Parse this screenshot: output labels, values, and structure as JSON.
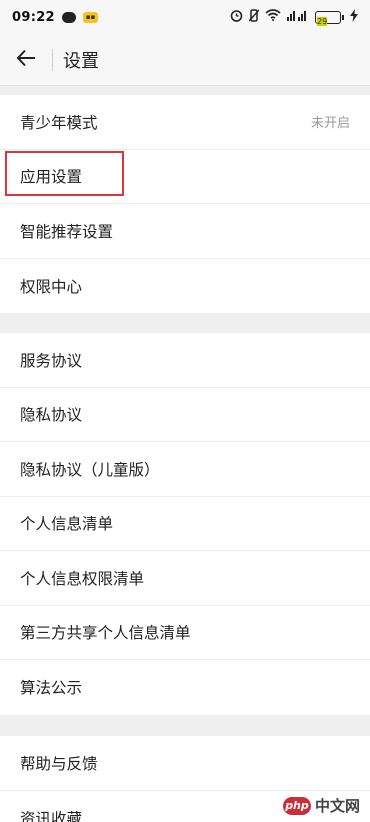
{
  "status_bar": {
    "time": "09:22",
    "battery_level": "29",
    "icons": [
      "wechat-icon",
      "app-badge-icon",
      "alarm-icon",
      "mute-icon",
      "wifi-icon",
      "signal-icon",
      "battery-icon",
      "charging-icon"
    ]
  },
  "header": {
    "title": "设置",
    "back_icon": "arrow-left-icon"
  },
  "sections": [
    {
      "items": [
        {
          "label": "青少年模式",
          "value": "未开启"
        },
        {
          "label": "应用设置"
        },
        {
          "label": "智能推荐设置"
        },
        {
          "label": "权限中心"
        }
      ]
    },
    {
      "items": [
        {
          "label": "服务协议"
        },
        {
          "label": "隐私协议"
        },
        {
          "label": "隐私协议（儿童版）"
        },
        {
          "label": "个人信息清单"
        },
        {
          "label": "个人信息权限清单"
        },
        {
          "label": "第三方共享个人信息清单"
        },
        {
          "label": "算法公示"
        }
      ]
    },
    {
      "items": [
        {
          "label": "帮助与反馈"
        },
        {
          "label": "资讯收藏"
        }
      ]
    }
  ],
  "highlight": {
    "target": "应用设置",
    "color": "#d9363e"
  },
  "watermark": {
    "logo": "php",
    "text": "中文网"
  }
}
